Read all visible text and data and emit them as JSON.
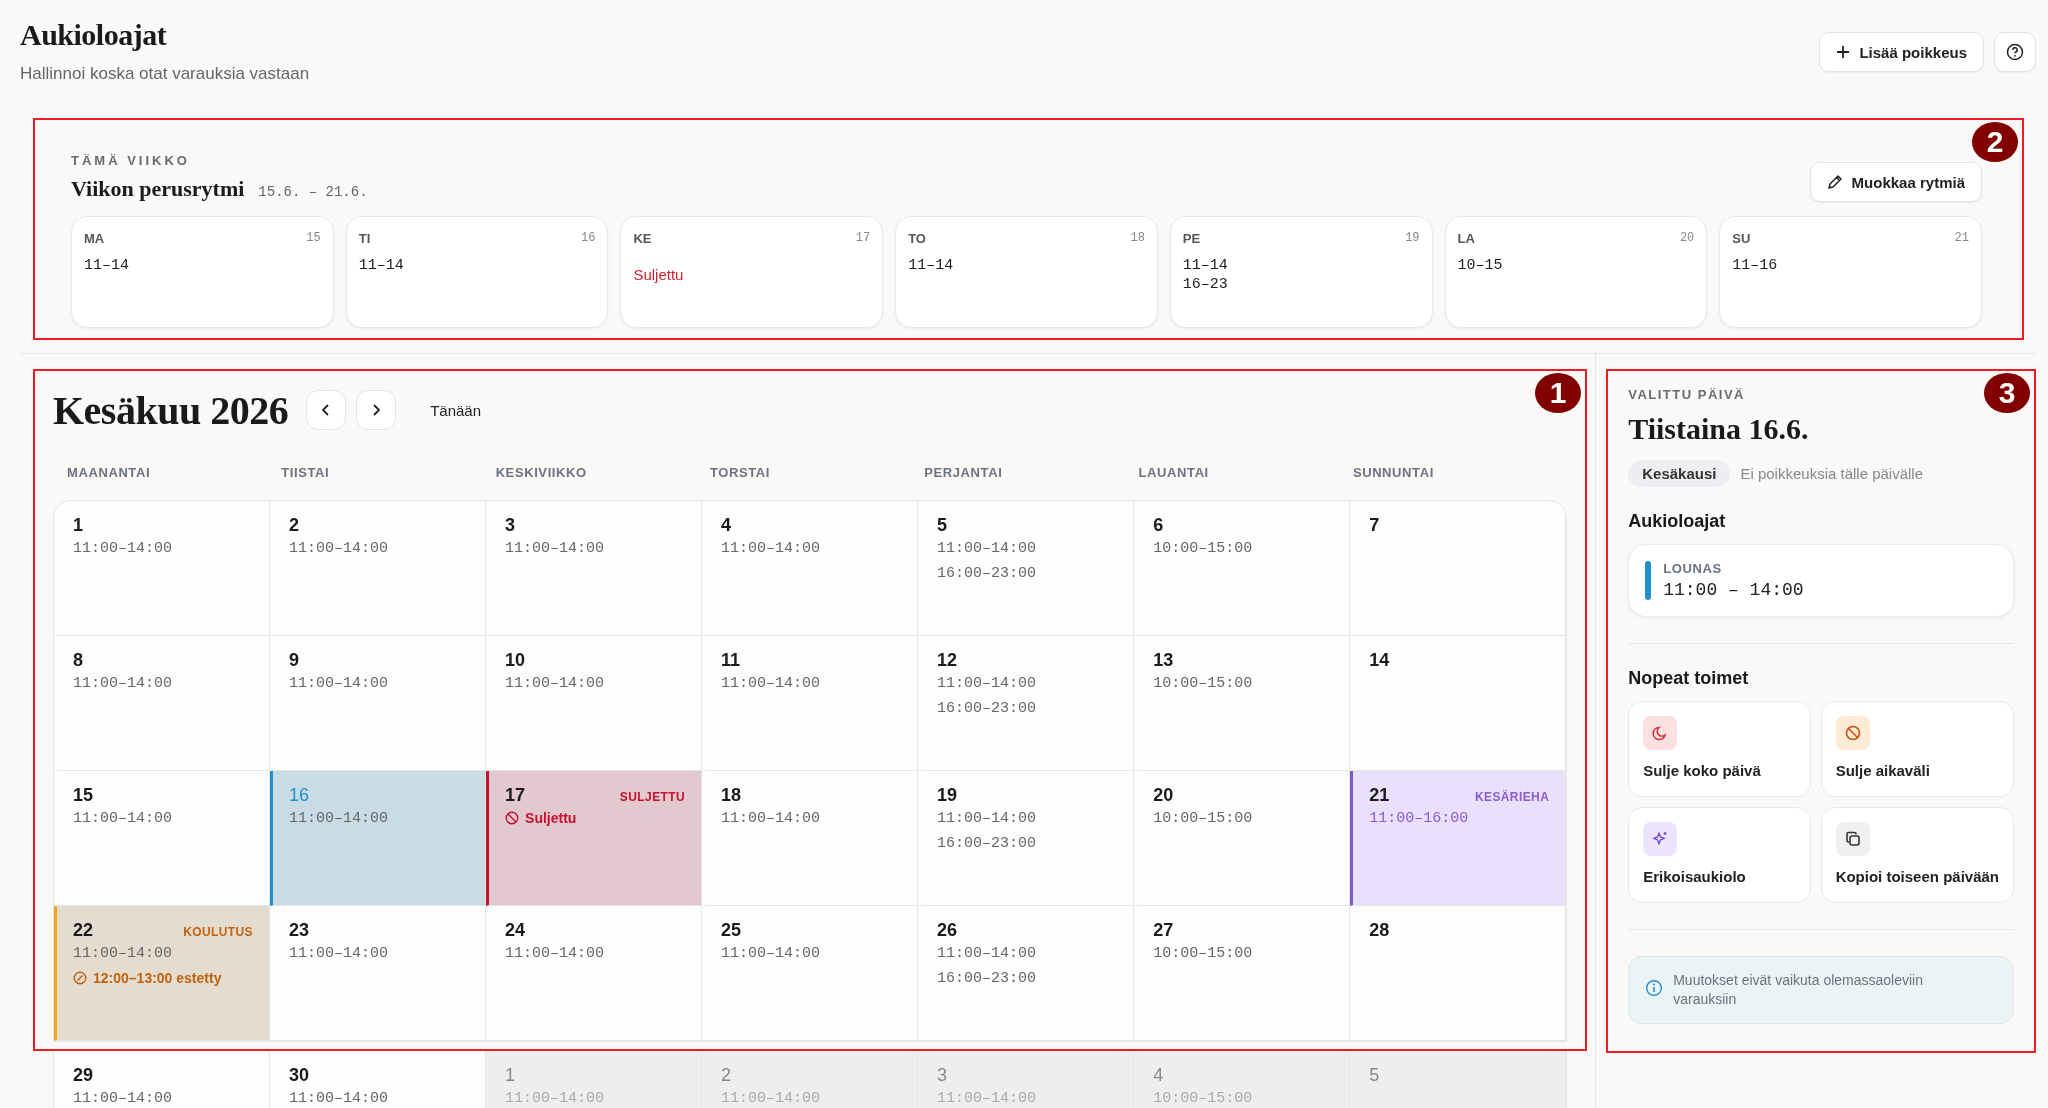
{
  "page": {
    "title": "Aukioloajat",
    "subtitle": "Hallinnoi koska otat varauksia vastaan",
    "add_button": "Lisää poikkeus"
  },
  "week": {
    "annotation": "2",
    "eyebrow": "TÄMÄ VIIKKO",
    "title": "Viikon perusrytmi",
    "range": "15.6. – 21.6.",
    "edit_button": "Muokkaa rytmiä",
    "days": [
      {
        "abbr": "MA",
        "date": "15",
        "kind": "open",
        "lines": [
          "11–14"
        ]
      },
      {
        "abbr": "TI",
        "date": "16",
        "kind": "open",
        "lines": [
          "11–14"
        ]
      },
      {
        "abbr": "KE",
        "date": "17",
        "kind": "closed",
        "lines": [
          "Suljettu"
        ]
      },
      {
        "abbr": "TO",
        "date": "18",
        "kind": "open",
        "lines": [
          "11–14"
        ]
      },
      {
        "abbr": "PE",
        "date": "19",
        "kind": "open",
        "lines": [
          "11–14",
          "16–23"
        ]
      },
      {
        "abbr": "LA",
        "date": "20",
        "kind": "open",
        "lines": [
          "10–15"
        ]
      },
      {
        "abbr": "SU",
        "date": "21",
        "kind": "open",
        "lines": [
          "11–16"
        ]
      }
    ]
  },
  "calendar": {
    "annotation": "1",
    "title": "Kesäkuu 2026",
    "today_button": "Tänään",
    "weekdays": [
      "MAANANTAI",
      "TIISTAI",
      "KESKIVIIKKO",
      "TORSTAI",
      "PERJANTAI",
      "LAUANTAI",
      "SUNNUNTAI"
    ],
    "weeks": [
      [
        {
          "day": "1",
          "kind": "normal",
          "selected": false,
          "times": [
            "11:00–14:00"
          ]
        },
        {
          "day": "2",
          "kind": "normal",
          "selected": false,
          "times": [
            "11:00–14:00"
          ]
        },
        {
          "day": "3",
          "kind": "normal",
          "selected": false,
          "times": [
            "11:00–14:00"
          ]
        },
        {
          "day": "4",
          "kind": "normal",
          "selected": false,
          "times": [
            "11:00–14:00"
          ]
        },
        {
          "day": "5",
          "kind": "normal",
          "selected": false,
          "times": [
            "11:00–14:00",
            "16:00–23:00"
          ]
        },
        {
          "day": "6",
          "kind": "normal",
          "selected": false,
          "times": [
            "10:00–15:00"
          ]
        },
        {
          "day": "7",
          "kind": "normal",
          "selected": false
        }
      ],
      [
        {
          "day": "8",
          "kind": "normal",
          "selected": false,
          "times": [
            "11:00–14:00"
          ]
        },
        {
          "day": "9",
          "kind": "normal",
          "selected": false,
          "times": [
            "11:00–14:00"
          ]
        },
        {
          "day": "10",
          "kind": "normal",
          "selected": false,
          "times": [
            "11:00–14:00"
          ]
        },
        {
          "day": "11",
          "kind": "normal",
          "selected": false,
          "times": [
            "11:00–14:00"
          ]
        },
        {
          "day": "12",
          "kind": "normal",
          "selected": false,
          "times": [
            "11:00–14:00",
            "16:00–23:00"
          ]
        },
        {
          "day": "13",
          "kind": "normal",
          "selected": false,
          "times": [
            "10:00–15:00"
          ]
        },
        {
          "day": "14",
          "kind": "normal",
          "selected": false
        }
      ],
      [
        {
          "day": "15",
          "kind": "normal",
          "selected": false,
          "times": [
            "11:00–14:00"
          ]
        },
        {
          "day": "16",
          "kind": "normal",
          "selected": true,
          "times": [
            "11:00–14:00"
          ]
        },
        {
          "day": "17",
          "kind": "closed",
          "selected": false,
          "tag": "SULJETTU",
          "note": "Suljettu"
        },
        {
          "day": "18",
          "kind": "normal",
          "selected": false,
          "times": [
            "11:00–14:00"
          ]
        },
        {
          "day": "19",
          "kind": "normal",
          "selected": false,
          "times": [
            "11:00–14:00",
            "16:00–23:00"
          ]
        },
        {
          "day": "20",
          "kind": "normal",
          "selected": false,
          "times": [
            "10:00–15:00"
          ]
        },
        {
          "day": "21",
          "kind": "event",
          "selected": false,
          "tag": "KESÄRIEHA",
          "times": [
            "11:00–16:00"
          ]
        }
      ],
      [
        {
          "day": "22",
          "kind": "training",
          "selected": false,
          "tag": "KOULUTUS",
          "times": [
            "11:00–14:00"
          ],
          "note": "12:00–13:00 estetty"
        },
        {
          "day": "23",
          "kind": "normal",
          "selected": false,
          "times": [
            "11:00–14:00"
          ]
        },
        {
          "day": "24",
          "kind": "normal",
          "selected": false,
          "times": [
            "11:00–14:00"
          ]
        },
        {
          "day": "25",
          "kind": "normal",
          "selected": false,
          "times": [
            "11:00–14:00"
          ]
        },
        {
          "day": "26",
          "kind": "normal",
          "selected": false,
          "times": [
            "11:00–14:00",
            "16:00–23:00"
          ]
        },
        {
          "day": "27",
          "kind": "normal",
          "selected": false,
          "times": [
            "10:00–15:00"
          ]
        },
        {
          "day": "28",
          "kind": "normal",
          "selected": false
        }
      ]
    ],
    "partial_week": [
      {
        "day": "29",
        "kind": "normal",
        "selected": false,
        "times": [
          "11:00–14:00"
        ]
      },
      {
        "day": "30",
        "kind": "normal",
        "selected": false,
        "times": [
          "11:00–14:00"
        ]
      },
      {
        "day": "1",
        "kind": "outside",
        "selected": false,
        "times": [
          "11:00–14:00"
        ]
      },
      {
        "day": "2",
        "kind": "outside",
        "selected": false,
        "times": [
          "11:00–14:00"
        ]
      },
      {
        "day": "3",
        "kind": "outside",
        "selected": false,
        "times": [
          "11:00–14:00"
        ]
      },
      {
        "day": "4",
        "kind": "outside",
        "selected": false,
        "times": [
          "10:00–15:00"
        ]
      },
      {
        "day": "5",
        "kind": "outside",
        "selected": false
      }
    ]
  },
  "panel": {
    "annotation": "3",
    "eyebrow": "VALITTU PÄIVÄ",
    "title": "Tiistaina 16.6.",
    "season": "Kesäkausi",
    "note": "Ei poikkeuksia tälle päivälle",
    "hours_heading": "Aukioloajat",
    "slots": [
      {
        "label": "LOUNAS",
        "time": "11:00 – 14:00",
        "color": "#1e90d0"
      }
    ],
    "actions_heading": "Nopeat toimet",
    "actions": [
      {
        "kind": "moon",
        "label": "Sulje koko päivä"
      },
      {
        "kind": "ban",
        "label": "Sulje aikaväli"
      },
      {
        "kind": "sparkle",
        "label": "Erikoisaukiolo"
      },
      {
        "kind": "copy",
        "label": "Kopioi toiseen päivään"
      }
    ],
    "info": "Muutokset eivät vaikuta olemassaoleviin varauksiin"
  }
}
